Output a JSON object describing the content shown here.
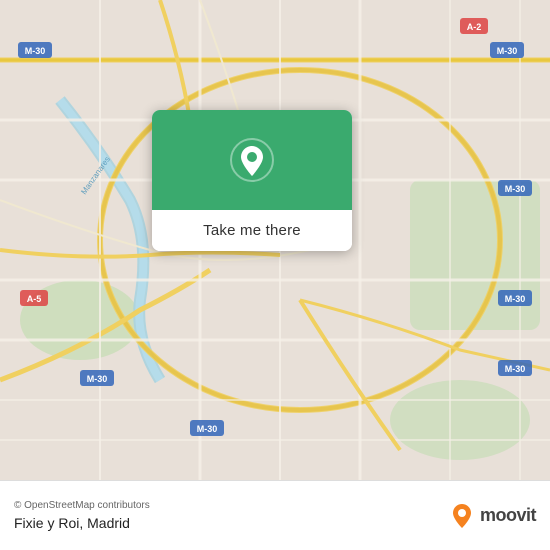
{
  "map": {
    "attribution": "© OpenStreetMap contributors",
    "background_color": "#e8e0d8"
  },
  "card": {
    "button_label": "Take me there",
    "pin_icon": "location-pin"
  },
  "bottom_bar": {
    "place_name": "Fixie y Roi, Madrid",
    "moovit_label": "moovit",
    "logo_icon": "moovit-logo"
  },
  "road_labels": [
    "M-30",
    "A-2",
    "A-5"
  ],
  "colors": {
    "green_card": "#3aaa6e",
    "road_yellow": "#f5d020",
    "road_major": "#e8c840",
    "map_bg": "#e8e0d8",
    "water": "#aad3df",
    "park": "#b8dfb3"
  }
}
